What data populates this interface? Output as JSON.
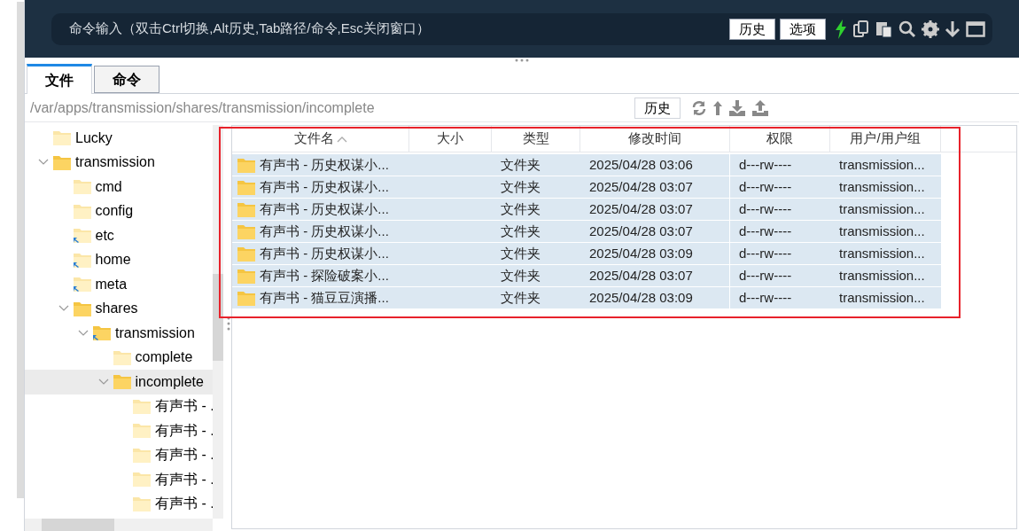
{
  "command_bar": {
    "prompt": "命令输入（双击Ctrl切换,Alt历史,Tab路径/命令,Esc关闭窗口）",
    "buttons": [
      "历史",
      "选项"
    ]
  },
  "tabs": [
    {
      "label": "文件",
      "selected": true
    },
    {
      "label": "命令",
      "selected": false
    }
  ],
  "path_bar": {
    "path": "/var/apps/transmission/shares/transmission/incomplete",
    "button": "历史"
  },
  "tree": [
    {
      "label": "Lucky",
      "kind": "folder",
      "selected": false
    },
    {
      "label": "transmission",
      "kind": "folder",
      "selected": false,
      "expanded": true,
      "children": [
        {
          "label": "cmd",
          "kind": "folder",
          "selected": false
        },
        {
          "label": "config",
          "kind": "folder",
          "selected": false
        },
        {
          "label": "etc",
          "kind": "link",
          "selected": false
        },
        {
          "label": "home",
          "kind": "link",
          "selected": false
        },
        {
          "label": "meta",
          "kind": "link",
          "selected": false
        },
        {
          "label": "shares",
          "kind": "folder",
          "selected": false,
          "expanded": true,
          "children": [
            {
              "label": "transmission",
              "kind": "link",
              "selected": false,
              "expanded": true,
              "children": [
                {
                  "label": "complete",
                  "kind": "folder",
                  "selected": false
                },
                {
                  "label": "incomplete",
                  "kind": "folder",
                  "selected": true,
                  "expanded": true,
                  "children": [
                    {
                      "label": "有声书 - .",
                      "kind": "folder",
                      "selected": false
                    },
                    {
                      "label": "有声书 - .",
                      "kind": "folder",
                      "selected": false
                    },
                    {
                      "label": "有声书 - .",
                      "kind": "folder",
                      "selected": false
                    },
                    {
                      "label": "有声书 - .",
                      "kind": "folder",
                      "selected": false
                    },
                    {
                      "label": "有声书 - .",
                      "kind": "folder",
                      "selected": false
                    }
                  ]
                }
              ]
            }
          ]
        }
      ]
    }
  ],
  "table": {
    "columns": [
      {
        "label": "文件名",
        "sorted": true
      },
      {
        "label": "大小",
        "sorted": false
      },
      {
        "label": "类型",
        "sorted": false
      },
      {
        "label": "修改时间",
        "sorted": false
      },
      {
        "label": "权限",
        "sorted": false
      },
      {
        "label": "用户/用户组",
        "sorted": false
      }
    ],
    "rows": [
      {
        "selected": true,
        "cells": [
          "有声书 - 历史权谋小...",
          "",
          "文件夹",
          "2025/04/28 03:06",
          "d---rw----",
          "transmission..."
        ]
      },
      {
        "selected": true,
        "cells": [
          "有声书 - 历史权谋小...",
          "",
          "文件夹",
          "2025/04/28 03:07",
          "d---rw----",
          "transmission..."
        ]
      },
      {
        "selected": true,
        "cells": [
          "有声书 - 历史权谋小...",
          "",
          "文件夹",
          "2025/04/28 03:07",
          "d---rw----",
          "transmission..."
        ]
      },
      {
        "selected": true,
        "cells": [
          "有声书 - 历史权谋小...",
          "",
          "文件夹",
          "2025/04/28 03:07",
          "d---rw----",
          "transmission..."
        ]
      },
      {
        "selected": true,
        "cells": [
          "有声书 - 历史权谋小...",
          "",
          "文件夹",
          "2025/04/28 03:09",
          "d---rw----",
          "transmission..."
        ]
      },
      {
        "selected": true,
        "cells": [
          "有声书 - 探险破案小...",
          "",
          "文件夹",
          "2025/04/28 03:07",
          "d---rw----",
          "transmission..."
        ]
      },
      {
        "selected": true,
        "cells": [
          "有声书 - 猫豆豆演播...",
          "",
          "文件夹",
          "2025/04/28 03:09",
          "d---rw----",
          "transmission..."
        ]
      }
    ]
  }
}
